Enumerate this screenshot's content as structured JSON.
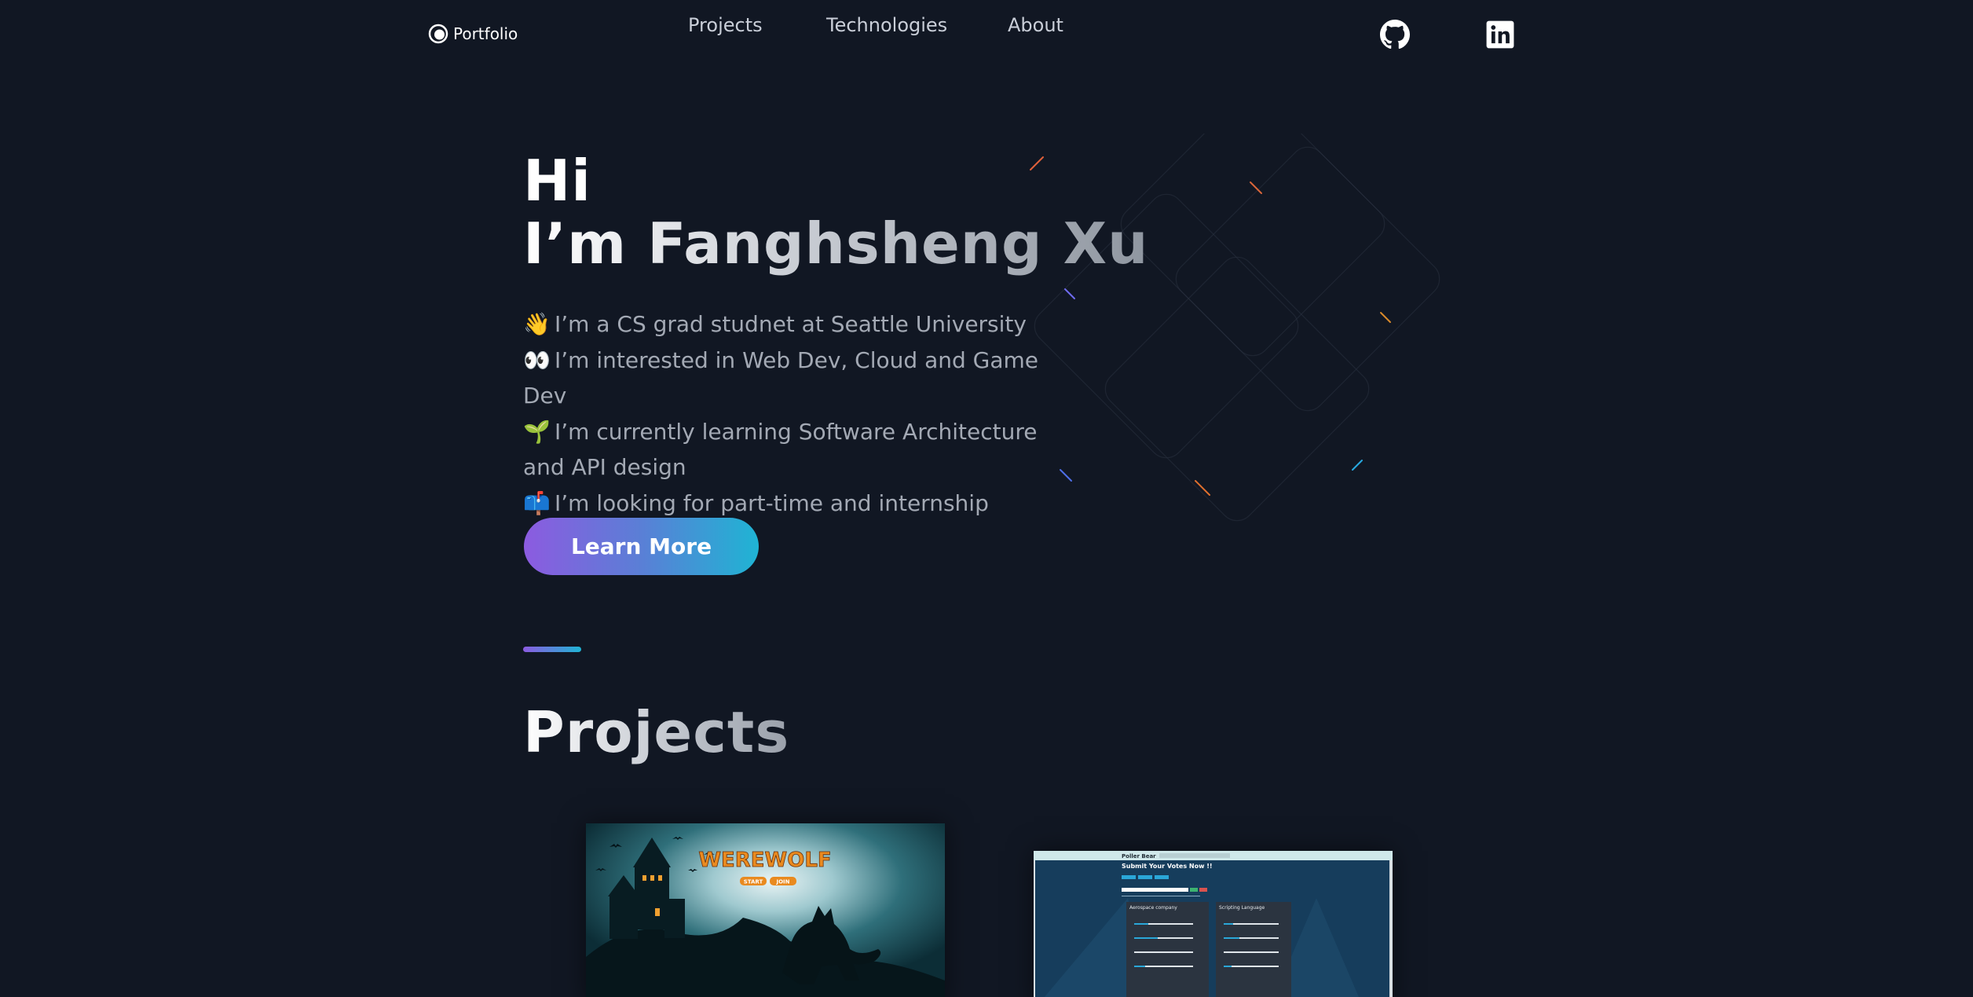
{
  "header": {
    "logo_label": "Portfolio",
    "nav": [
      {
        "label": "Projects"
      },
      {
        "label": "Technologies"
      },
      {
        "label": "About"
      }
    ],
    "social": [
      {
        "icon": "github-icon"
      },
      {
        "icon": "linkedin-icon"
      }
    ]
  },
  "hero": {
    "greeting": "Hi",
    "name": "I’m Fanghsheng Xu",
    "bullets": [
      {
        "emoji": "👋",
        "text": "I’m a CS grad studnet at Seattle University"
      },
      {
        "emoji": "👀",
        "text": "I’m interested in Web Dev, Cloud and Game Dev"
      },
      {
        "emoji": "🌱",
        "text": "I’m currently learning Software Architecture and API design"
      },
      {
        "emoji": "📫",
        "text": "I’m looking for part-time and internship"
      }
    ],
    "cta_label": "Learn More"
  },
  "projects_section": {
    "title": "Projects",
    "cards": [
      {
        "name": "werewolf",
        "title_text": "WEREWOLF",
        "button_1": "START",
        "button_2": "JOIN"
      },
      {
        "name": "poller-bear",
        "app_name": "Poller Bear",
        "heading": "Submit Your Votes Now !!",
        "panel_1_title": "Aerospace company",
        "panel_2_title": "Scripting Language"
      }
    ]
  },
  "colors": {
    "background": "#111723",
    "gradient_start": "#8c5be0",
    "gradient_end": "#1fb4d4",
    "text_muted": "#a3a9b4"
  }
}
